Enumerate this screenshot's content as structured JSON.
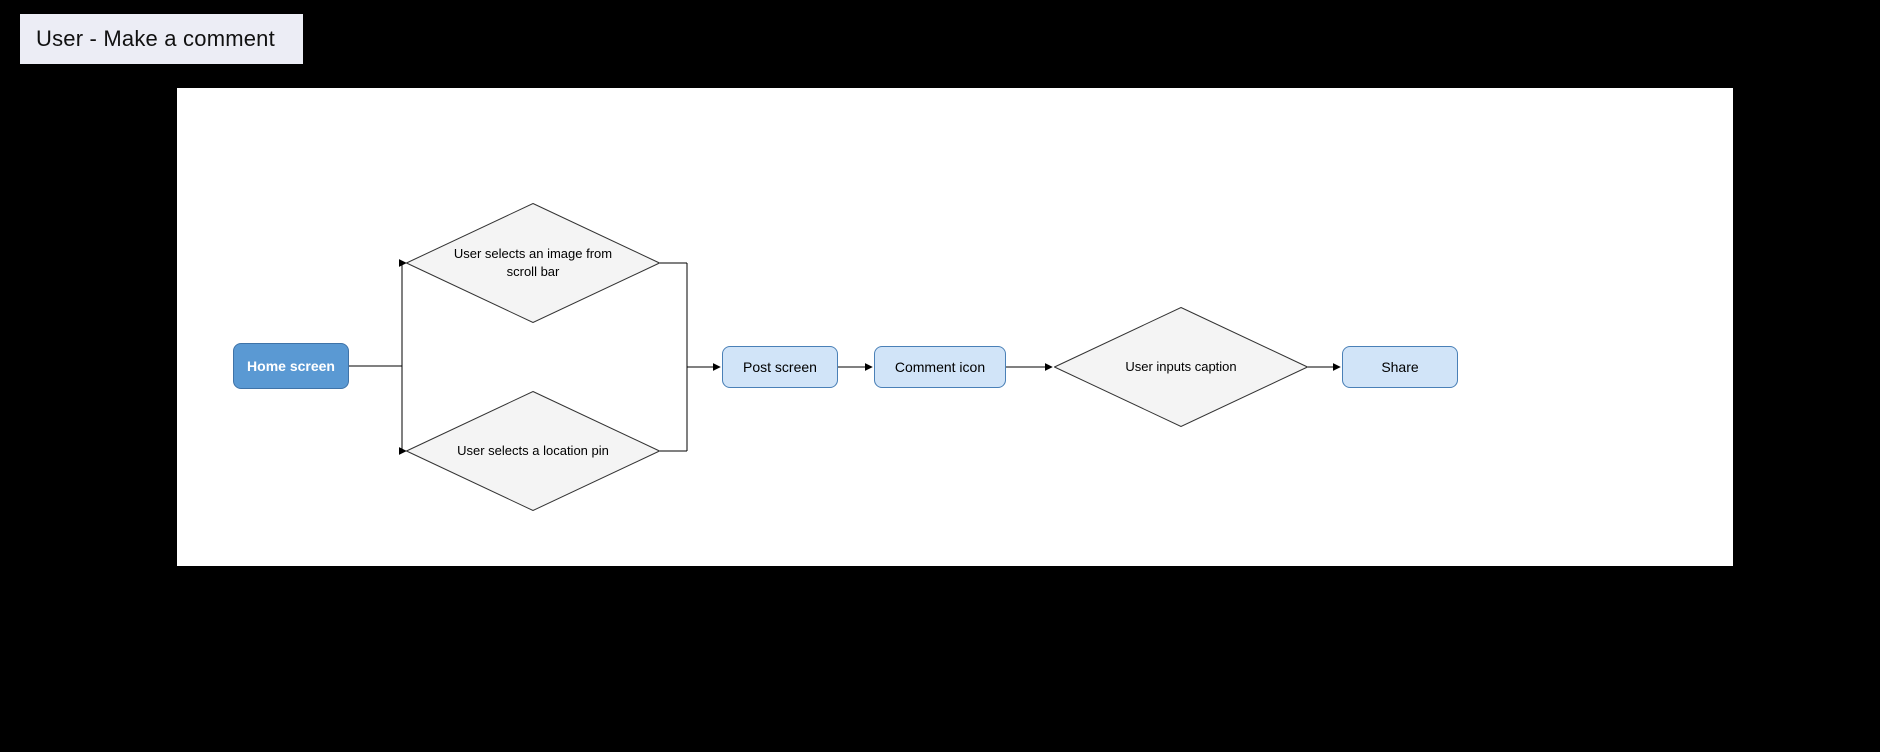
{
  "title": "User - Make a comment",
  "nodes": {
    "home": "Home screen",
    "select_image": "User selects an image from scroll bar",
    "select_location": "User selects a location pin",
    "post_screen": "Post screen",
    "comment_icon": "Comment icon",
    "inputs_caption": "User inputs caption",
    "share": "Share"
  }
}
